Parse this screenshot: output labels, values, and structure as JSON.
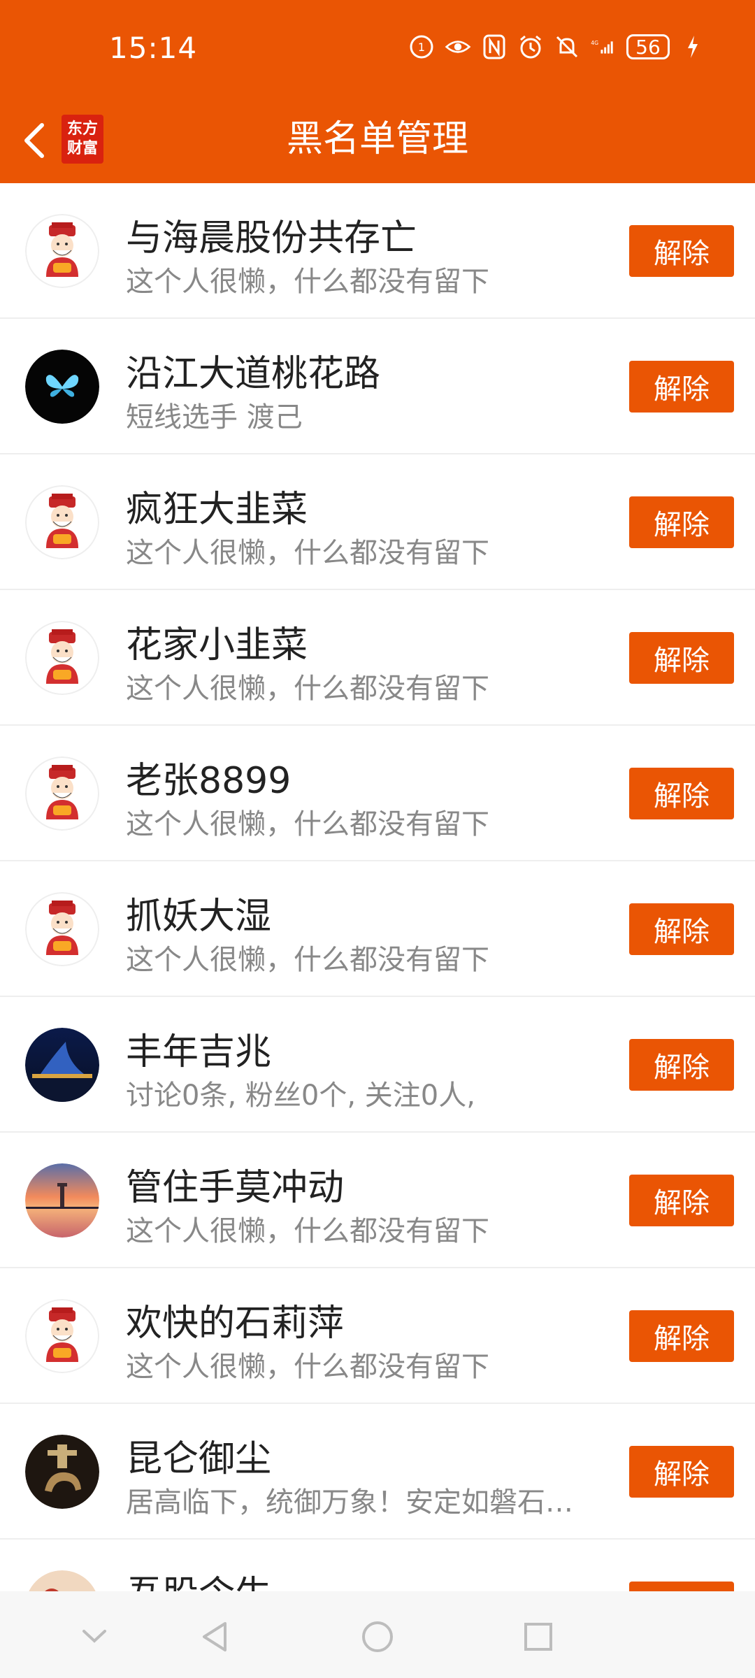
{
  "status_bar": {
    "time": "15:14",
    "battery": "56",
    "icons": [
      "hd-icon",
      "eye-icon",
      "nfc-icon",
      "alarm-icon",
      "mute-icon",
      "signal-4g-icon",
      "charging-icon"
    ]
  },
  "header": {
    "logo_line1": "东方",
    "logo_line2": "财富",
    "title": "黑名单管理",
    "accent_color": "#ea5504"
  },
  "blacklist": [
    {
      "name": "与海晨股份共存亡",
      "desc": "这个人很懒，什么都没有留下",
      "avatar": "caishen"
    },
    {
      "name": "沿江大道桃花路",
      "desc": "短线选手 渡己",
      "avatar": "butterfly"
    },
    {
      "name": "疯狂大韭菜",
      "desc": "这个人很懒，什么都没有留下",
      "avatar": "caishen"
    },
    {
      "name": "花家小韭菜",
      "desc": "这个人很懒，什么都没有留下",
      "avatar": "caishen"
    },
    {
      "name": "老张8899",
      "desc": "这个人很懒，什么都没有留下",
      "avatar": "caishen"
    },
    {
      "name": "抓妖大湿",
      "desc": "这个人很懒，什么都没有留下",
      "avatar": "caishen"
    },
    {
      "name": "丰年吉兆",
      "desc": "讨论0条, 粉丝0个, 关注0人,",
      "avatar": "night-building"
    },
    {
      "name": "管住手莫冲动",
      "desc": "这个人很懒，什么都没有留下",
      "avatar": "sunset-lighthouse"
    },
    {
      "name": "欢快的石莉萍",
      "desc": "这个人很懒，什么都没有留下",
      "avatar": "caishen"
    },
    {
      "name": "昆仑御尘",
      "desc": "居高临下，统御万象！安定如磐石…",
      "avatar": "bronze-horse"
    },
    {
      "name": "吾股令生",
      "desc": "",
      "avatar": "partial"
    }
  ],
  "unblock_label": "解除",
  "nav": {
    "icons": [
      "nav-collapse-icon",
      "nav-back-icon",
      "nav-home-icon",
      "nav-recents-icon"
    ]
  }
}
